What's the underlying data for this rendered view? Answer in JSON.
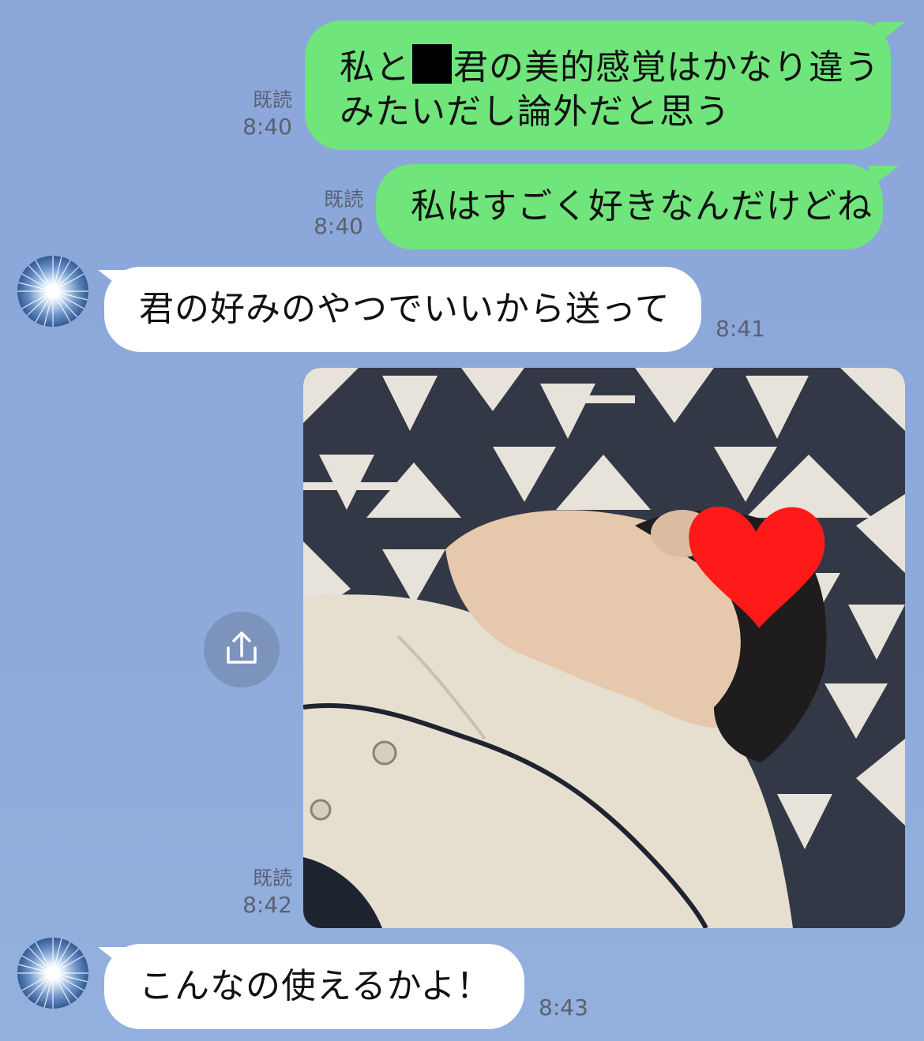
{
  "messages": [
    {
      "id": "m1",
      "direction": "outgoing",
      "lines": [
        "私と",
        "君の美的感覚はかなり違う",
        "みたいだし論外だと思う"
      ],
      "has_redaction": true,
      "read_label": "既読",
      "time": "8:40"
    },
    {
      "id": "m2",
      "direction": "outgoing",
      "text": "私はすごく好きなんだけどね",
      "read_label": "既読",
      "time": "8:40"
    },
    {
      "id": "m3",
      "direction": "incoming",
      "text": "君の好みのやつでいいから送って",
      "time": "8:41"
    },
    {
      "id": "m4",
      "direction": "outgoing",
      "type": "image",
      "read_label": "既読",
      "time": "8:42"
    },
    {
      "id": "m5",
      "direction": "incoming",
      "text": "こんなの使えるかよ！",
      "time": "8:43"
    }
  ],
  "colors": {
    "background": "#8ea9d9",
    "outgoing_bubble": "#6fe57b",
    "incoming_bubble": "#ffffff",
    "meta_text": "#5a6170",
    "heart": "#ff1a1a"
  },
  "icons": {
    "share": "share-icon",
    "avatar": "avatar-image"
  }
}
